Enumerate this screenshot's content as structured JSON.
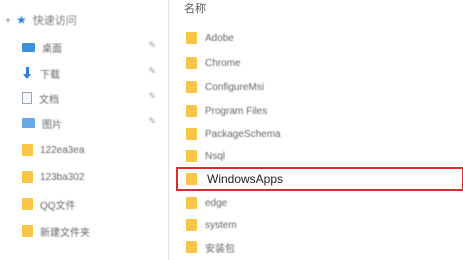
{
  "sidebar": {
    "quick_access_label": "快速访问",
    "items": [
      {
        "label": "桌面",
        "icon": "desktop-icon",
        "pinned": true
      },
      {
        "label": "下载",
        "icon": "download-icon",
        "pinned": true
      },
      {
        "label": "文档",
        "icon": "document-icon",
        "pinned": true
      },
      {
        "label": "图片",
        "icon": "pictures-icon",
        "pinned": true
      },
      {
        "label": "122ea3ea",
        "icon": "folder-icon",
        "pinned": false
      },
      {
        "label": "123ba302",
        "icon": "folder-icon",
        "pinned": false
      },
      {
        "label": "QQ文件",
        "icon": "folder-icon",
        "pinned": false
      },
      {
        "label": "新建文件夹",
        "icon": "folder-icon",
        "pinned": false
      }
    ]
  },
  "main": {
    "column_header": "名称",
    "folders": [
      {
        "name": "Adobe"
      },
      {
        "name": "Chrome"
      },
      {
        "name": "ConfigureMsi"
      },
      {
        "name": "Program Files"
      },
      {
        "name": "PackageSchema"
      },
      {
        "name": "Nsql"
      },
      {
        "name": "WindowsApps",
        "selected": true
      },
      {
        "name": "edge"
      },
      {
        "name": "system"
      },
      {
        "name": "安装包"
      }
    ]
  },
  "colors": {
    "selection_border": "#d92d2d",
    "folder": "#f6c644",
    "accent": "#2f7ed8"
  }
}
